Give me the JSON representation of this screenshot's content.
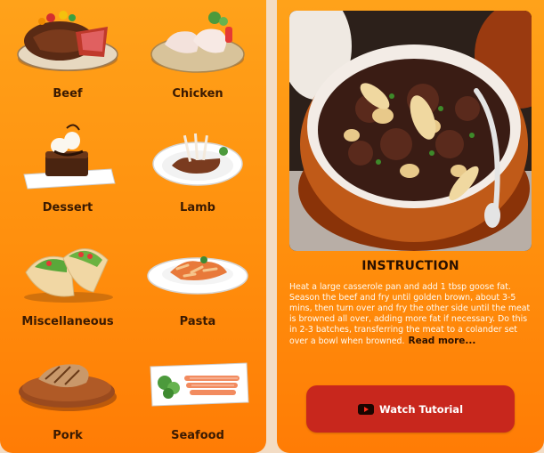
{
  "categories": [
    {
      "label": "Beef",
      "icon": "beef-steak-icon"
    },
    {
      "label": "Chicken",
      "icon": "chicken-icon"
    },
    {
      "label": "Dessert",
      "icon": "dessert-icon"
    },
    {
      "label": "Lamb",
      "icon": "lamb-chops-icon"
    },
    {
      "label": "Miscellaneous",
      "icon": "taco-icon"
    },
    {
      "label": "Pasta",
      "icon": "pasta-icon"
    },
    {
      "label": "Pork",
      "icon": "pork-chop-icon"
    },
    {
      "label": "Seafood",
      "icon": "salmon-icon"
    }
  ],
  "detail": {
    "title": "INSTRUCTION",
    "instructions": "Heat a large casserole pan and add 1 tbsp goose fat. Season the beef and fry until golden brown, about 3-5 mins, then turn over and fry the other side until the meat is browned all over, adding more fat if necessary. Do this in 2-3 batches, transferring the meat to a colander set over a bowl when browned.",
    "read_more": "Read more...",
    "watch_button": "Watch Tutorial",
    "watch_icon": "youtube-icon"
  },
  "colors": {
    "panel_top": "#ffa21a",
    "panel_bottom": "#ff7c05",
    "button": "#c8271d",
    "label": "#3a1a02"
  }
}
